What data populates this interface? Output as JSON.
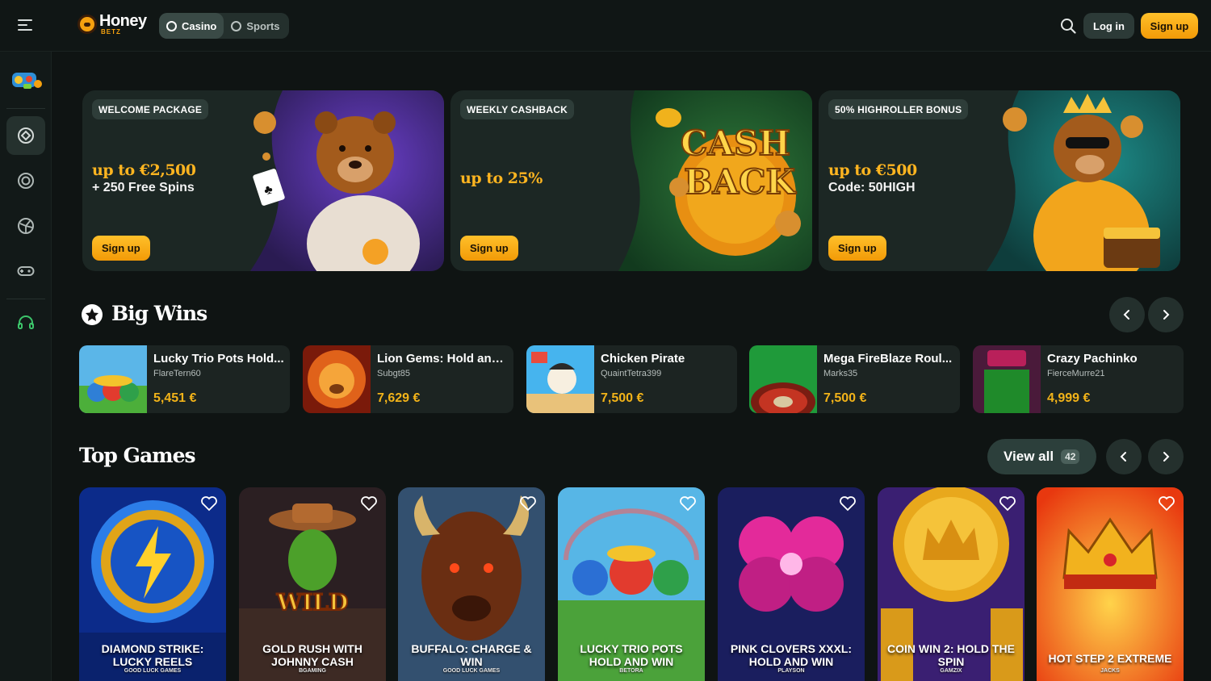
{
  "header": {
    "logo_main": "Honey",
    "logo_sub": "BETZ",
    "modes": [
      {
        "label": "Casino",
        "active": true
      },
      {
        "label": "Sports",
        "active": false
      }
    ],
    "login_label": "Log in",
    "signup_label": "Sign up",
    "accent_color": "#f5a10f"
  },
  "sidebar": {
    "items": [
      {
        "name": "casino-chip-icon",
        "active": true
      },
      {
        "name": "live-casino-icon",
        "active": false
      },
      {
        "name": "sports-ball-icon",
        "active": false
      },
      {
        "name": "gamepad-icon",
        "active": false
      },
      {
        "name": "support-headset-icon",
        "active": false
      }
    ]
  },
  "promos": [
    {
      "tag": "WELCOME PACKAGE",
      "headline": "up to €2,500",
      "sub": "+ 250 Free Spins",
      "button": "Sign up"
    },
    {
      "tag": "WEEKLY CASHBACK",
      "headline": "up to 25%",
      "sub": "",
      "button": "Sign up",
      "art_text_1": "CASH",
      "art_text_2": "BACK"
    },
    {
      "tag": "50% HIGHROLLER BONUS",
      "headline": "up to €500",
      "sub": "Code: 50HIGH",
      "button": "Sign up"
    }
  ],
  "big_wins": {
    "title": "Big Wins",
    "items": [
      {
        "game": "Lucky Trio Pots Hold...",
        "user": "FlareTern60",
        "amount": "5,451 €"
      },
      {
        "game": "Lion Gems: Hold and...",
        "user": "Subgt85",
        "amount": "7,629 €"
      },
      {
        "game": "Chicken Pirate",
        "user": "QuaintTetra399",
        "amount": "7,500 €"
      },
      {
        "game": "Mega FireBlaze Roul...",
        "user": "Marks35",
        "amount": "7,500 €"
      },
      {
        "game": "Crazy Pachinko",
        "user": "FierceMurre21",
        "amount": "4,999 €"
      }
    ]
  },
  "top_games": {
    "title": "Top Games",
    "view_all_label": "View all",
    "view_all_count": "42",
    "items": [
      {
        "title": "DIAMOND STRIKE: LUCKY REELS",
        "provider": "GOOD LUCK GAMES"
      },
      {
        "title": "GOLD RUSH WITH JOHNNY CASH",
        "provider": "BGAMING",
        "art_text": "WILD"
      },
      {
        "title": "BUFFALO: CHARGE & WIN",
        "provider": "GOOD LUCK GAMES"
      },
      {
        "title": "LUCKY TRIO POTS HOLD AND WIN",
        "provider": "BETORA"
      },
      {
        "title": "PINK CLOVERS XXXL: HOLD AND WIN",
        "provider": "PLAYSON"
      },
      {
        "title": "COIN WIN 2: HOLD THE SPIN",
        "provider": "GAMZIX"
      },
      {
        "title": "HOT STEP 2 EXTREME",
        "provider": "JACKS"
      }
    ]
  }
}
